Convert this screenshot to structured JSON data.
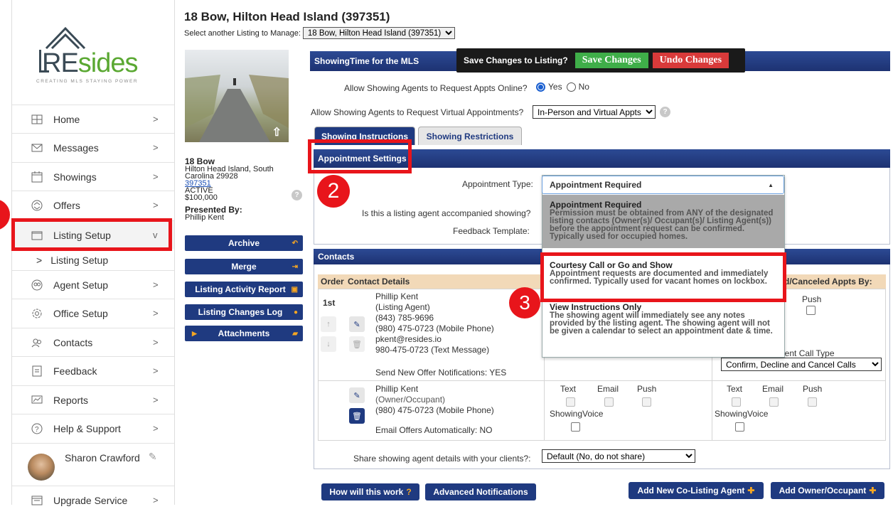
{
  "sidebar": {
    "logo_text": "REsides",
    "logo_tagline": "CREATING MLS STAYING POWER",
    "items": [
      {
        "label": "Home",
        "icon": "home-icon",
        "chev": ">"
      },
      {
        "label": "Messages",
        "icon": "envelope-icon",
        "chev": ">"
      },
      {
        "label": "Showings",
        "icon": "calendar-icon",
        "chev": ">"
      },
      {
        "label": "Offers",
        "icon": "offers-icon",
        "chev": ">"
      },
      {
        "label": "Listing Setup",
        "icon": "folder-icon",
        "chev": "v"
      },
      {
        "label": "Agent Setup",
        "icon": "agent-icon",
        "chev": ">"
      },
      {
        "label": "Office Setup",
        "icon": "gear-icon",
        "chev": ">"
      },
      {
        "label": "Contacts",
        "icon": "contacts-icon",
        "chev": ">"
      },
      {
        "label": "Feedback",
        "icon": "feedback-icon",
        "chev": ">"
      },
      {
        "label": "Reports",
        "icon": "reports-icon",
        "chev": ">"
      },
      {
        "label": "Help & Support",
        "icon": "help-icon",
        "chev": ">"
      },
      {
        "label": "Upgrade Service",
        "icon": "upgrade-icon",
        "chev": ">"
      }
    ],
    "subitem": {
      "arrow": ">",
      "label": "Listing Setup"
    },
    "user": {
      "name": "Sharon Crawford"
    }
  },
  "header": {
    "title": "18 Bow, Hilton Head Island (397351)",
    "select_label": "Select another Listing to Manage:",
    "select_value": "18 Bow, Hilton Head Island (397351)"
  },
  "listing": {
    "street": "18 Bow",
    "city": "Hilton Head Island, South",
    "state_zip": "Carolina 29928",
    "mls": "397351",
    "status": "ACTIVE",
    "price": "$100,000",
    "presented_label": "Presented By:",
    "presented_name": "Phillip Kent",
    "buttons": [
      "Archive",
      "Merge",
      "Listing Activity Report",
      "Listing Changes Log",
      "Attachments"
    ]
  },
  "savebar": {
    "prompt": "Save Changes to Listing?",
    "save": "Save Changes",
    "undo": "Undo Changes"
  },
  "showingtime": {
    "title": "ShowingTime for the MLS",
    "allow_online_label": "Allow Showing Agents to Request Appts Online?",
    "yes": "Yes",
    "no": "No",
    "virtual_label": "Allow Showing Agents to Request Virtual Appointments?",
    "virtual_value": "In-Person and Virtual Appts",
    "tabs": [
      "Showing Instructions",
      "Showing Restrictions"
    ]
  },
  "appointment": {
    "title": "Appointment Settings",
    "type_label": "Appointment Type:",
    "type_value": "Appointment Required",
    "accompanied_label": "Is this a listing agent accompanied showing?",
    "feedback_label": "Feedback Template:",
    "options": [
      {
        "title": "Appointment Required",
        "desc": "Permission must be obtained from ANY of the designated listing contacts (Owner(s)/ Occupant(s)/ Listing Agent(s)) before the appointment request can be confirmed. Typically used for occupied homes."
      },
      {
        "title": "Courtesy Call or Go and Show",
        "desc": "Appointment requests are documented and immediately confirmed. Typically used for vacant homes on lockbox."
      },
      {
        "title": "View Instructions Only",
        "desc": "The showing agent will immediately see any notes provided by the listing agent. The showing agent will not be given a calendar to select an appointment date & time."
      }
    ]
  },
  "contacts": {
    "title": "Contacts",
    "col_order": "Order",
    "col_details": "Contact Details",
    "col_canceled": "d/Canceled Appts By:",
    "row1": {
      "order": "1st",
      "lines": [
        "Phillip Kent",
        "(Listing Agent)",
        "(843) 785-9696",
        "(980) 475-0723 (Mobile Phone)",
        "pkent@resides.io",
        "980-475-0723 (Text Message)"
      ],
      "notif": "Send New Offer Notifications: YES",
      "push": "Push",
      "call_type_label": "nent Call Type",
      "call_type_value": "Confirm, Decline and Cancel Calls"
    },
    "row2": {
      "lines": [
        "Phillip Kent",
        "(Owner/Occupant)",
        "(980) 475-0723 (Mobile Phone)"
      ],
      "notif": "Email Offers Automatically: NO",
      "text": "Text",
      "email": "Email",
      "push": "Push",
      "voice": "ShowingVoice"
    },
    "share_label": "Share showing agent details with your clients?:",
    "share_value": "Default (No, do not share)"
  },
  "bottom": {
    "how": "How will this work",
    "advanced": "Advanced Notifications",
    "add_co": "Add New Co-Listing Agent",
    "add_owner": "Add Owner/Occupant"
  },
  "annotations": {
    "two": "2",
    "three": "3"
  },
  "colors": {
    "accent_blue": "#1f3a80",
    "save_green": "#3fae49",
    "undo_red": "#d93a3a",
    "highlight_red": "#e8151b",
    "logo_green": "#5aa832"
  }
}
